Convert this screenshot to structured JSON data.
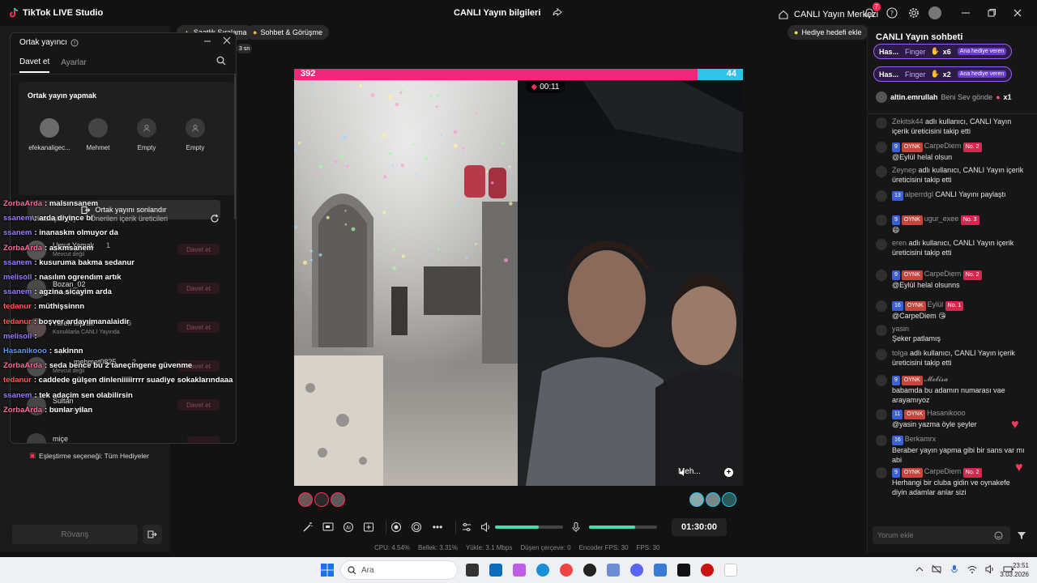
{
  "titlebar": {
    "app_title": "TikTok LIVE Studio",
    "center_title": "CANLI Yayın bilgileri",
    "live_center": "CANLI Yayın Merkezi",
    "notif_count": "7"
  },
  "top_chips": {
    "ranking": "Saatlik Sıralama",
    "chat": "Sohbet & Görüşme",
    "gift_goal": "Hediye hedefi ekle",
    "partial": "3 sn"
  },
  "cohost": {
    "title": "Ortak yayıncı",
    "tabs": [
      "Davet et",
      "Ayarlar"
    ],
    "section_title": "Ortak yayın yapmak",
    "slots": [
      "efekanaligec...",
      "Mehmet",
      "Empty",
      "Empty"
    ],
    "end_button": "Ortak yayını sonlandır",
    "suggestions_label": "Önerilen içerik üreticileri",
    "suggestions_prefix": "Arkadaşlar (0)",
    "invite_label": "Davet et",
    "suggestions": [
      {
        "name": "Umut Yamak",
        "sub": "Mevcut değil",
        "count": "1"
      },
      {
        "name": "Bozan_02",
        "sub": "Mevcut değil",
        "count": ""
      },
      {
        "name": "Yaren toprak",
        "sub": "Konuklarla CANLI Yayında",
        "count": "6"
      },
      {
        "name": "mehmet0825",
        "sub": "Mevcut değil",
        "count": "2"
      },
      {
        "name": "Sultan",
        "sub": "Mevcut değil",
        "count": ""
      },
      {
        "name": "miçe",
        "sub": "",
        "count": ""
      }
    ],
    "matching": "Eşleştirme seçeneği: Tüm Hediyeler",
    "rematch": "Rövanş"
  },
  "overlay_chat": [
    {
      "name": "ZorbaArda",
      "color": "#ff6b9d",
      "text": "malsınsanem"
    },
    {
      "name": "ssanem",
      "color": "#9b7bff",
      "text": "arda diyince bi"
    },
    {
      "name": "ssanem",
      "color": "#9b7bff",
      "text": "inanaskm olmuyor da"
    },
    {
      "name": "ZorbaArda",
      "color": "#ff6b9d",
      "text": "askmsanem"
    },
    {
      "name": "ssanem",
      "color": "#9b7bff",
      "text": "kusuruma bakma sedanur"
    },
    {
      "name": "melisoll",
      "color": "#9b7bff",
      "text": "nasılım ogrendım artık"
    },
    {
      "name": "ssanem",
      "color": "#9b7bff",
      "text": "agzina sicayim arda"
    },
    {
      "name": "tedanur",
      "color": "#ff5a5a",
      "text": "müthişsinnn"
    },
    {
      "name": "tedanur",
      "color": "#ff5a5a",
      "text": "boşver ardayıimanalaidir"
    },
    {
      "name": "melisoll",
      "color": "#9b7bff",
      "text": ""
    },
    {
      "name": "Hasanikooo",
      "color": "#5a9bff",
      "text": "sakinnn"
    },
    {
      "name": "ZorbaArda",
      "color": "#ff6b9d",
      "text": "seda bence bu 2 taneçingene güvenme"
    },
    {
      "name": "tedanur",
      "color": "#ff5a5a",
      "text": "caddede gülşen dinleniiiiirrrr suadiye sokaklarındaaa"
    },
    {
      "name": "ssanem",
      "color": "#9b7bff",
      "text": "tek adaçim sen olabilirsin"
    },
    {
      "name": "ZorbaArda",
      "color": "#ff6b9d",
      "text": "bunlar yilan"
    }
  ],
  "battle": {
    "score_left": "392",
    "score_right": "44",
    "timer": "00:11",
    "right_label": "Meh..."
  },
  "controls": {
    "time": "01:30:00"
  },
  "stats": {
    "cpu": "CPU: 4.54%",
    "memory": "Bellek: 3.31%",
    "upload": "Yükle: 3.1 Mbps",
    "dropped": "Düşen çerçeve: 0",
    "encoder": "Encoder FPS: 30",
    "fps": "FPS: 30"
  },
  "right_chat": {
    "title": "CANLI Yayın sohbeti",
    "gifts": [
      {
        "user": "Has...",
        "gift": "Finger",
        "count": "x6",
        "tag": "Ana hediye veren"
      },
      {
        "user": "Has...",
        "gift": "Finger",
        "count": "x2",
        "tag": "Ana hediye veren"
      },
      {
        "user": "altin.emrullah",
        "gift": "Beni Sev gönde",
        "count": "x1",
        "tag": ""
      }
    ],
    "messages": [
      {
        "user": "Zekitsk44",
        "text": "adlı kullanıcı, CANLI Yayın içerik üreticisini takip etti",
        "lvl": "",
        "fan": "",
        "rank": ""
      },
      {
        "user": "CarpeDiem",
        "text": "@Eylül helal olsun",
        "lvl": "9",
        "fan": "OYNK",
        "rank": "No. 2"
      },
      {
        "user": "Zeynep",
        "text": "adlı kullanıcı, CANLI Yayın içerik üreticisini takip etti",
        "lvl": "",
        "fan": "",
        "rank": ""
      },
      {
        "user": "alperrdgl",
        "text": "CANLI Yayını paylaştı",
        "lvl": "13",
        "fan": "",
        "rank": ""
      },
      {
        "user": "ugur_exee",
        "text": "😄",
        "lvl": "9",
        "fan": "OYNK",
        "rank": "No. 3"
      },
      {
        "user": "eren",
        "text": "adlı kullanıcı, CANLI Yayın içerik üreticisini takip etti",
        "lvl": "",
        "fan": "",
        "rank": ""
      },
      {
        "user": "CarpeDiem",
        "text": "@Eylül helal olsunns",
        "lvl": "9",
        "fan": "OYNK",
        "rank": "No. 2"
      },
      {
        "user": "Eylül",
        "text": "@CarpeDiem 😘",
        "lvl": "16",
        "fan": "OYNK",
        "rank": "No. 1"
      },
      {
        "user": "yasin",
        "text": "Şeker patlamış",
        "lvl": "",
        "fan": "",
        "rank": ""
      },
      {
        "user": "tolga",
        "text": "adlı kullanıcı, CANLI Yayın içerik üreticisini takip etti",
        "lvl": "",
        "fan": "",
        "rank": ""
      },
      {
        "user": "𝓜𝓮𝓵𝓲𝓼𝓪",
        "text": "babamda bu adamın numarası vae arayamıyoz",
        "lvl": "9",
        "fan": "OYNK",
        "rank": ""
      },
      {
        "user": "Hasanikooo",
        "text": "@yasin yazma öyle şeyler",
        "lvl": "11",
        "fan": "OYNK",
        "rank": ""
      },
      {
        "user": "Berkamrx",
        "text": "Beraber yayın yapma gibi bir sans var mı abi",
        "lvl": "16",
        "fan": "",
        "rank": ""
      },
      {
        "user": "CarpeDiem",
        "text": "Herhangi bir cluba gidin ve oynakefe diyin adamlar anlar sizi",
        "lvl": "9",
        "fan": "OYNK",
        "rank": "No. 2"
      }
    ],
    "comment_placeholder": "Yorum ekle"
  },
  "taskbar": {
    "search": "Ara",
    "time": "23:51",
    "date": "3.03.2026"
  }
}
